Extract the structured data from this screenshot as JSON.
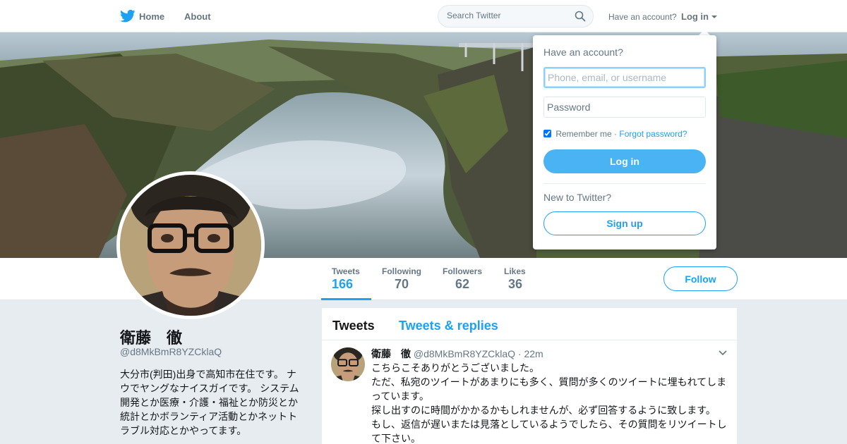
{
  "nav": {
    "home_label": "Home",
    "about_label": "About",
    "search_placeholder": "Search Twitter",
    "have_account": "Have an account?",
    "login_label": "Log in",
    "logo_icon": "twitter-bird-icon",
    "search_icon": "search-icon"
  },
  "profile": {
    "name": "衛藤　徹",
    "handle": "@d8MkBmR8YZCklaQ",
    "bio": "大分市(判田)出身で高知市在住です。 ナウでヤングなナイスガイです。 システム開発とか医療・介護・福祉とか防災とか統計とかボランティア活動とかネットトラブル対応とかやってます。"
  },
  "stats": [
    {
      "label": "Tweets",
      "value": "166",
      "active": true
    },
    {
      "label": "Following",
      "value": "70",
      "active": false
    },
    {
      "label": "Followers",
      "value": "62",
      "active": false
    },
    {
      "label": "Likes",
      "value": "36",
      "active": false
    }
  ],
  "follow_label": "Follow",
  "timeline": {
    "tabs": [
      {
        "label": "Tweets",
        "active": true
      },
      {
        "label": "Tweets & replies",
        "active": false
      }
    ],
    "tweet": {
      "name": "衛藤　徹",
      "handle": "@d8MkBmR8YZCklaQ",
      "time": "· 22m",
      "lines": [
        "こちらこそありがとうございました。",
        "ただ、私宛のツイートがあまりにも多く、質問が多くのツイートに埋もれてしまっています。",
        "探し出すのに時間がかかるかもしれませんが、必ず回答するように致します。",
        "もし、返信が遅いまたは見落としているようでしたら、その質問をリツイートして下さい。"
      ]
    }
  },
  "login_dropdown": {
    "title": "Have an account?",
    "username_placeholder": "Phone, email, or username",
    "password_placeholder": "Password",
    "remember_label": "Remember me",
    "separator": "·",
    "forgot_label": "Forgot password?",
    "login_button": "Log in",
    "new_label": "New to Twitter?",
    "signup_button": "Sign up"
  },
  "colors": {
    "accent": "#1da1f2",
    "button_fill": "#4ab3f4",
    "background": "#e6ecf0"
  }
}
